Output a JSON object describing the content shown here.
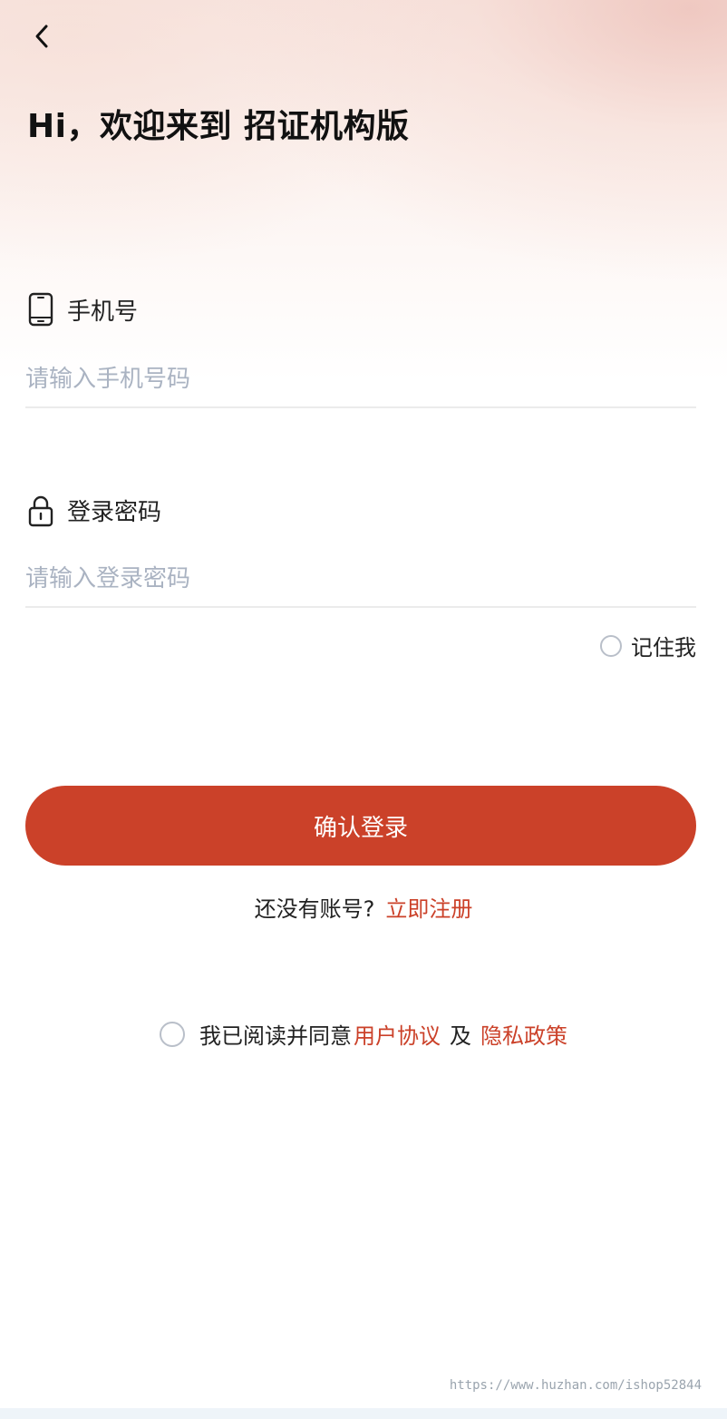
{
  "header": {
    "back_icon": "chevron-left-icon",
    "title": "Hi，欢迎来到 招证机构版"
  },
  "form": {
    "phone": {
      "icon": "mobile-phone-icon",
      "label": "手机号",
      "placeholder": "请输入手机号码",
      "value": ""
    },
    "password": {
      "icon": "lock-icon",
      "label": "登录密码",
      "placeholder": "请输入登录密码",
      "value": ""
    },
    "remember_me": {
      "label": "记住我",
      "checked": false
    },
    "submit_label": "确认登录"
  },
  "register": {
    "prompt": "还没有账号?",
    "link": "立即注册"
  },
  "agreement": {
    "checked": false,
    "text": "我已阅读并同意",
    "user_agreement": "用户协议",
    "conjunction": "及",
    "privacy_policy": "隐私政策"
  },
  "watermark": "https://www.huzhan.com/ishop52844",
  "colors": {
    "accent": "#cb4129",
    "placeholder": "#aab3c2",
    "divider": "#ebebeb",
    "radio_border": "#b9bfc9"
  }
}
